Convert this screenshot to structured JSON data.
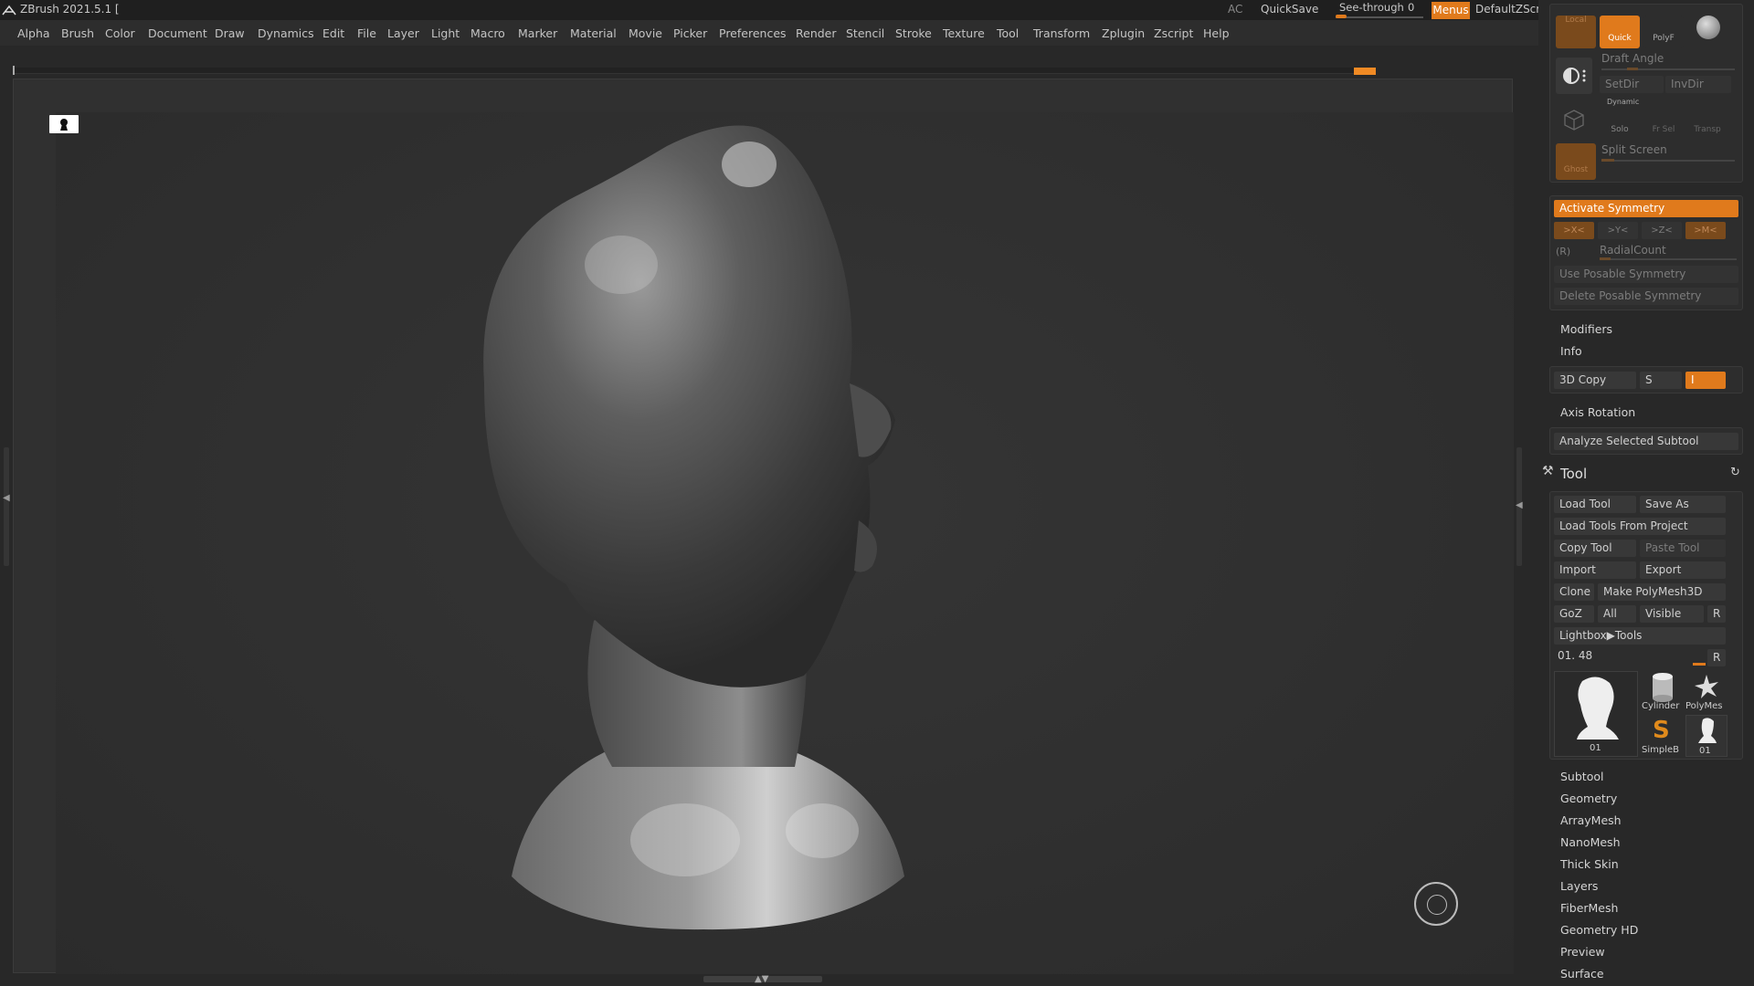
{
  "app": {
    "title": "ZBrush 2021.5.1 [",
    "ac_label": "AC",
    "quicksave_label": "QuickSave",
    "seethrough_label": "See-through",
    "seethrough_value": "0",
    "menus_label": "Menus",
    "zscript_label": "DefaultZScript"
  },
  "menubar": [
    "Alpha",
    "Brush",
    "Color",
    "Document",
    "Draw",
    "Dynamics",
    "Edit",
    "File",
    "Layer",
    "Light",
    "Macro",
    "Marker",
    "Material",
    "Movie",
    "Picker",
    "Preferences",
    "Render",
    "Stencil",
    "Stroke",
    "Texture",
    "Tool",
    "Transform",
    "Zplugin",
    "Zscript",
    "Help"
  ],
  "top_tools": {
    "local": "Local",
    "quick": "Quick",
    "polyf": "PolyF",
    "draft_angle": "Draft Angle",
    "setdir": "SetDir",
    "invdir": "InvDir",
    "dynamic": "Dynamic",
    "solo": "Solo",
    "frsel": "Fr Sel",
    "transp": "Transp",
    "ghost": "Ghost",
    "split_screen": "Split Screen"
  },
  "symmetry": {
    "activate": "Activate Symmetry",
    "x": ">X<",
    "y": ">Y<",
    "z": ">Z<",
    "m": ">M<",
    "r": "(R)",
    "radialcount": "RadialCount",
    "use_posable": "Use Posable Symmetry",
    "delete_posable": "Delete Posable Symmetry"
  },
  "transform_sections": {
    "modifiers": "Modifiers",
    "info": "Info",
    "copy3d": "3D Copy",
    "s": "S",
    "i": "I",
    "axis_rotation": "Axis Rotation",
    "analyze": "Analyze Selected Subtool"
  },
  "tool": {
    "title": "Tool",
    "load_tool": "Load Tool",
    "save_as": "Save As",
    "load_from_project": "Load Tools From Project",
    "copy_tool": "Copy Tool",
    "paste_tool": "Paste Tool",
    "import": "Import",
    "export": "Export",
    "clone": "Clone",
    "make_polymesh": "Make PolyMesh3D",
    "goz": "GoZ",
    "all": "All",
    "visible": "Visible",
    "r": "R",
    "lightbox": "Lightbox▶Tools",
    "current_label": "01. 48",
    "current_tool_name": "01",
    "thumbs": [
      "Cylinder",
      "PolyMes",
      "SimpleB",
      "01"
    ]
  },
  "tool_sections": [
    "Subtool",
    "Geometry",
    "ArrayMesh",
    "NanoMesh",
    "Thick Skin",
    "Layers",
    "FiberMesh",
    "Geometry HD",
    "Preview",
    "Surface"
  ],
  "colors": {
    "accent": "#e07a1c",
    "panel": "#282828",
    "canvas": "#303030"
  }
}
